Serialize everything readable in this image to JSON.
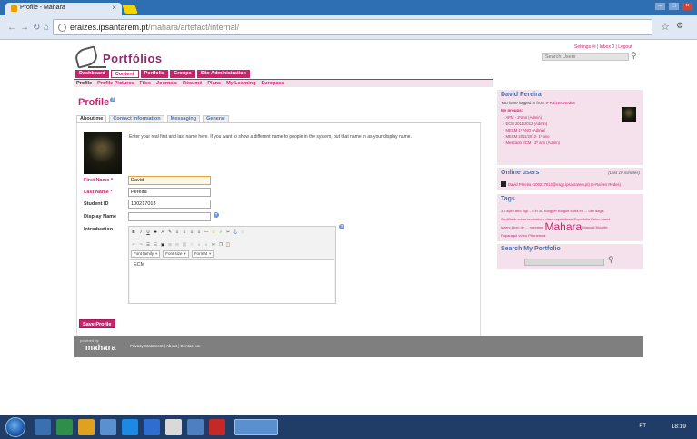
{
  "browser": {
    "tab_title": "Profile - Mahara",
    "url_host": "eraizes.ipsantarem.pt",
    "url_path": "/mahara/artefact/internal/"
  },
  "site": {
    "logo_text": "Portfólios",
    "top_links": "Settings ✉ | Inbox 0 | Logout",
    "search_placeholder": "Search Users"
  },
  "main_nav": [
    {
      "label": "Dashboard"
    },
    {
      "label": "Content",
      "active": true
    },
    {
      "label": "Portfolio"
    },
    {
      "label": "Groups"
    },
    {
      "label": "Site Administration"
    }
  ],
  "sub_nav": [
    {
      "label": "Profile",
      "active": true
    },
    {
      "label": "Profile Pictures"
    },
    {
      "label": "Files"
    },
    {
      "label": "Journals"
    },
    {
      "label": "Résumé"
    },
    {
      "label": "Plans"
    },
    {
      "label": "My Learning"
    },
    {
      "label": "Europass"
    }
  ],
  "profile": {
    "heading": "Profile",
    "tabs": [
      {
        "label": "About me",
        "active": true
      },
      {
        "label": "Contact information"
      },
      {
        "label": "Messaging"
      },
      {
        "label": "General"
      }
    ],
    "intro": "Enter your real first and last name here. If you want to show a different name to people in the system, put that name in as your display name.",
    "fields": {
      "first_name_label": "First Name *",
      "first_name_value": "David",
      "last_name_label": "Last Name *",
      "last_name_value": "Pereira",
      "student_id_label": "Student ID",
      "student_id_value": "100217013",
      "display_name_label": "Display Name",
      "display_name_value": "",
      "introduction_label": "Introduction"
    },
    "editor": {
      "font_family": "Font family",
      "font_size": "Font size",
      "format": "Format",
      "content": "ECM"
    },
    "save_label": "Save Profile"
  },
  "sidebar": {
    "user_name": "David Pereira",
    "logged_in_prefix": "You have logged in from ",
    "logged_in_link": "e-Raízes Redes",
    "groups_title": "My groups:",
    "groups": [
      "APM - 2ºano (Admin)",
      "ECM 2011/2012 (Admin)",
      "MECM 1º ANO (Admin)",
      "MECM 2011/2012- 1º ano",
      "Mestrado ECM - 2º ano (Admin)"
    ],
    "online_title": "Online users",
    "online_note": "(Last 10 minutes)",
    "online_user": "David Pereira (100217013@esgs.ipsantarem.pt) (e-Raízes Redes)",
    "tags_title": "Tags",
    "tags_line1": "3D  açim  ano lógi... o in 3D  Blogger  Blogue  caría en ... uim dagis",
    "tags_line2": "CoolBook  curso  curriculum vitae  espontânea  Exporfolio  Eclen mané",
    "tags_line3_a": "lazery  Livro de ... noreame",
    "tags_big": "Mahara",
    "tags_line3_b": "Manual  Moodle",
    "tags_line4": "Paparagui  vídeo  Phonemca",
    "search_title": "Search My Portfolio"
  },
  "footer": {
    "powered_by": "powered by",
    "logo": "mahara",
    "links": "Privacy Statement | About | Contact us"
  },
  "taskbar": {
    "tray_lang": "PT",
    "clock": "18:19"
  }
}
